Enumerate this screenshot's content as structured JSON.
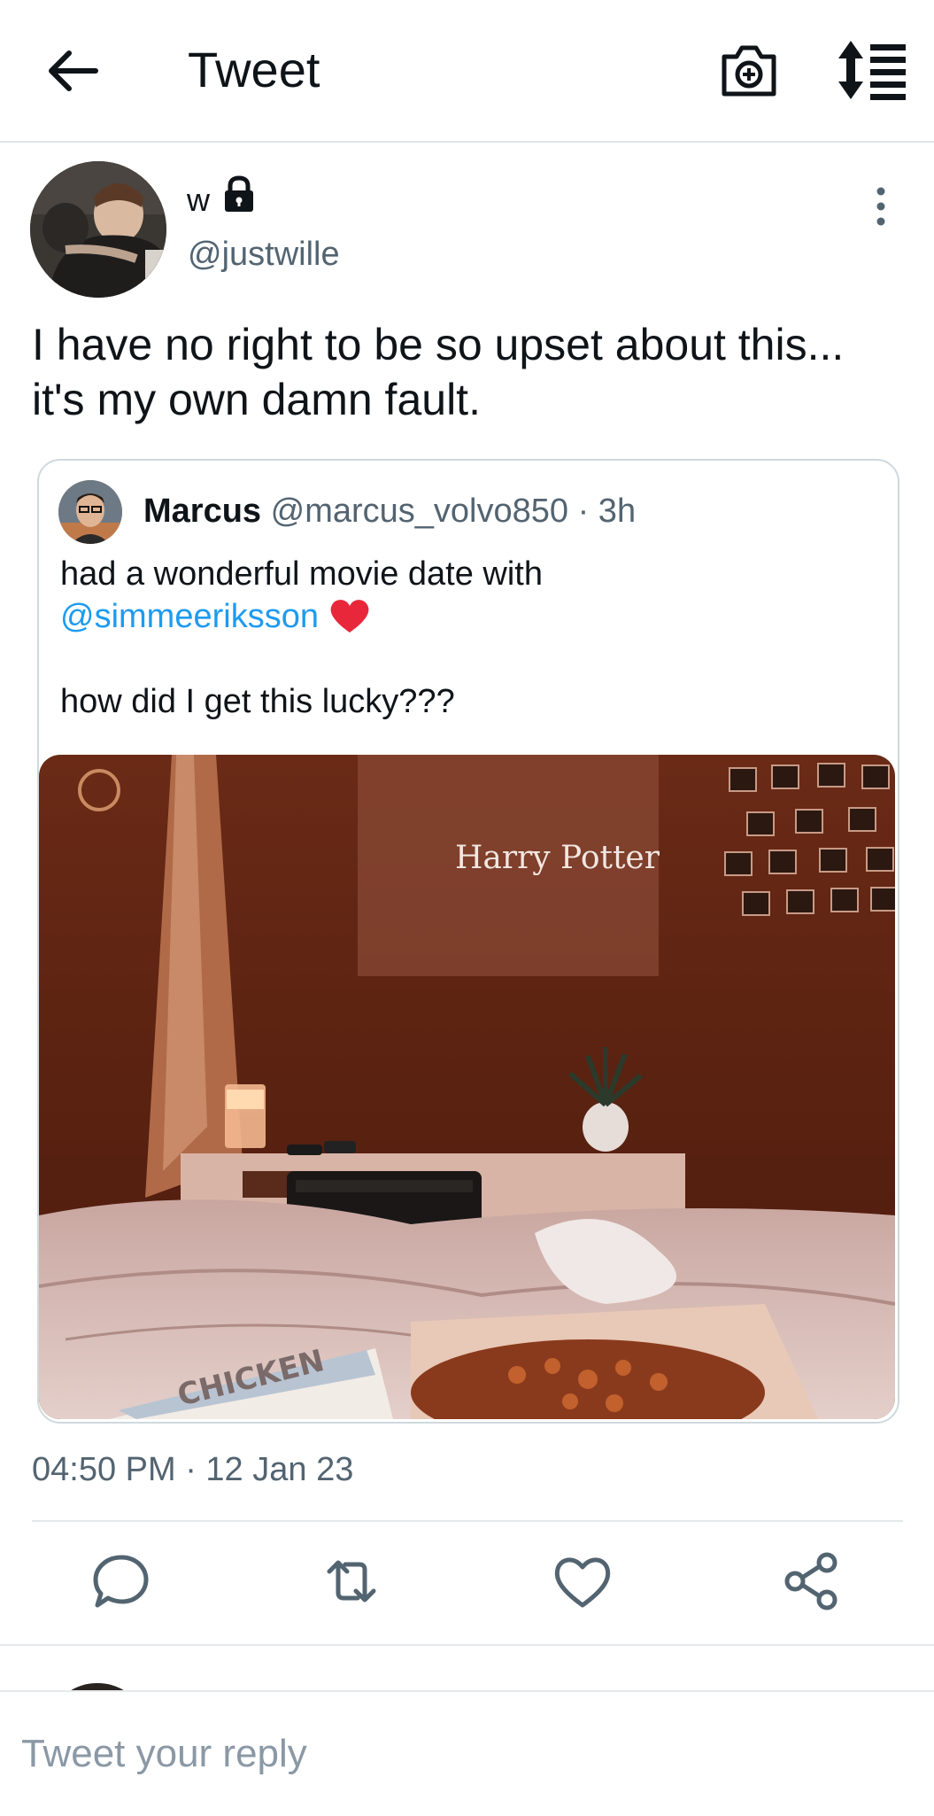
{
  "header": {
    "title": "Tweet",
    "icons": [
      "back-arrow-icon",
      "camera-plus-icon",
      "sort-list-icon"
    ]
  },
  "tweet": {
    "author_name": "w",
    "author_handle": "@justwille",
    "protected": true,
    "text": "I have no right to be so upset about this...\nit's my own damn fault.",
    "timestamp": "04:50 PM · 12 Jan 23"
  },
  "quoted": {
    "name": "Marcus",
    "handle": "@marcus_volvo850",
    "time": "· 3h",
    "line1": "had a wonderful movie date with",
    "mention": "@simmeeriksson",
    "line2": "how did I get this lucky???",
    "photo_text": {
      "screen_title": "Harry Potter",
      "box_text": "CHICKEN"
    }
  },
  "actions": [
    "reply-icon",
    "retweet-icon",
    "like-icon",
    "share-icon"
  ],
  "reply": {
    "placeholder": "Tweet your reply"
  },
  "colors": {
    "text": "#0f1419",
    "secondary": "#536471",
    "accent": "#1d9bf0",
    "border": "#cfd9de"
  }
}
